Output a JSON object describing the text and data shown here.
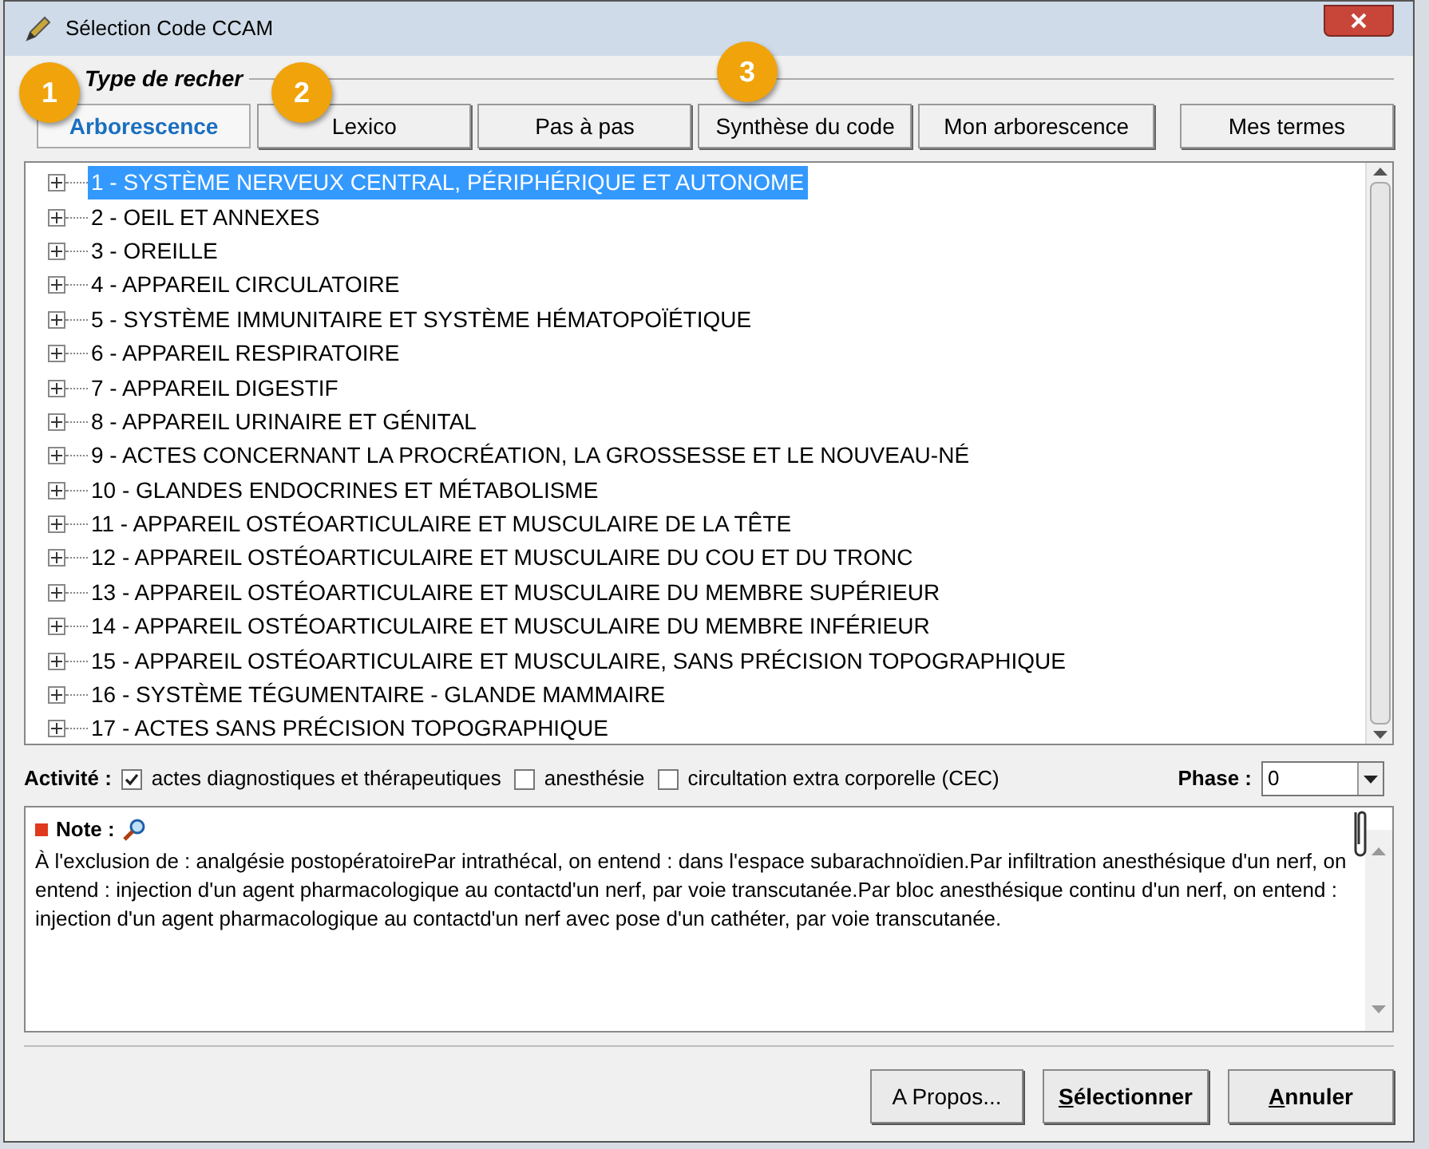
{
  "window": {
    "title": "Sélection Code CCAM"
  },
  "group_title": "Type de recher",
  "tabs": [
    {
      "label": "Arborescence",
      "selected": true
    },
    {
      "label": "Lexico",
      "selected": false
    },
    {
      "label": "Pas à pas",
      "selected": false
    },
    {
      "label": "Synthèse du code",
      "selected": false
    },
    {
      "label": "Mon arborescence",
      "selected": false
    },
    {
      "label": "Mes termes",
      "selected": false
    }
  ],
  "tree": [
    {
      "label": "1 - SYSTÈME NERVEUX CENTRAL, PÉRIPHÉRIQUE ET AUTONOME",
      "selected": true
    },
    {
      "label": "2 - OEIL ET ANNEXES",
      "selected": false
    },
    {
      "label": "3 - OREILLE",
      "selected": false
    },
    {
      "label": "4 - APPAREIL CIRCULATOIRE",
      "selected": false
    },
    {
      "label": "5 - SYSTÈME IMMUNITAIRE ET SYSTÈME HÉMATOPOÏÉTIQUE",
      "selected": false
    },
    {
      "label": "6 - APPAREIL RESPIRATOIRE",
      "selected": false
    },
    {
      "label": "7 - APPAREIL DIGESTIF",
      "selected": false
    },
    {
      "label": "8 - APPAREIL URINAIRE ET GÉNITAL",
      "selected": false
    },
    {
      "label": "9 - ACTES CONCERNANT LA PROCRÉATION, LA GROSSESSE ET LE NOUVEAU-NÉ",
      "selected": false
    },
    {
      "label": "10 - GLANDES ENDOCRINES ET MÉTABOLISME",
      "selected": false
    },
    {
      "label": "11 - APPAREIL OSTÉOARTICULAIRE ET MUSCULAIRE DE LA TÊTE",
      "selected": false
    },
    {
      "label": "12 - APPAREIL OSTÉOARTICULAIRE ET MUSCULAIRE DU COU ET DU TRONC",
      "selected": false
    },
    {
      "label": "13 - APPAREIL OSTÉOARTICULAIRE ET MUSCULAIRE DU MEMBRE SUPÉRIEUR",
      "selected": false
    },
    {
      "label": "14 - APPAREIL OSTÉOARTICULAIRE ET MUSCULAIRE DU MEMBRE INFÉRIEUR",
      "selected": false
    },
    {
      "label": "15 - APPAREIL OSTÉOARTICULAIRE ET MUSCULAIRE, SANS PRÉCISION TOPOGRAPHIQUE",
      "selected": false
    },
    {
      "label": "16 - SYSTÈME TÉGUMENTAIRE - GLANDE MAMMAIRE",
      "selected": false
    },
    {
      "label": "17 - ACTES SANS PRÉCISION TOPOGRAPHIQUE",
      "selected": false
    }
  ],
  "activity": {
    "label": "Activité :",
    "options": [
      {
        "label": "actes diagnostiques et thérapeutiques",
        "checked": true
      },
      {
        "label": "anesthésie",
        "checked": false
      },
      {
        "label": "circultation extra corporelle (CEC)",
        "checked": false
      }
    ]
  },
  "phase": {
    "label": "Phase :",
    "value": "0"
  },
  "note": {
    "label": "Note :",
    "text": "À l'exclusion de : analgésie postopératoirePar intrathécal, on entend : dans l'espace subarachnoïdien.Par infiltration anesthésique d'un nerf, on entend : injection d'un agent pharmacologique au contactd'un nerf, par voie transcutanée.Par bloc anesthésique continu d'un nerf, on entend : injection d'un agent pharmacologique au contactd'un nerf avec pose d'un cathéter, par voie transcutanée."
  },
  "buttons": [
    {
      "label": "A Propos...",
      "mnemonic": false
    },
    {
      "label": "Sélectionner",
      "mnemonic": true
    },
    {
      "label": "Annuler",
      "mnemonic": true
    }
  ],
  "badges": [
    "1",
    "2",
    "3"
  ]
}
